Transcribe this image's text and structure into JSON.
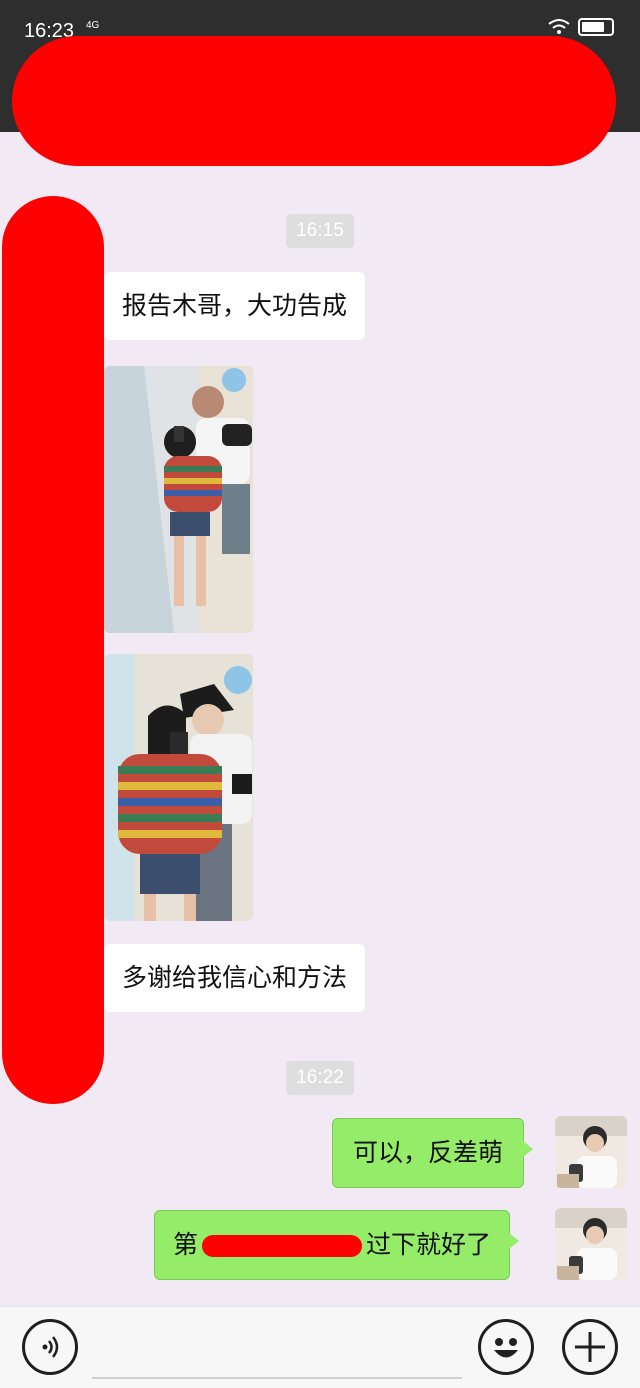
{
  "status_bar": {
    "time": "16:23",
    "network": "4G"
  },
  "messages": [
    {
      "type": "timestamp",
      "text": "16:15"
    },
    {
      "type": "text",
      "direction": "in",
      "text": "报告木哥，大功告成"
    },
    {
      "type": "image",
      "direction": "in"
    },
    {
      "type": "image",
      "direction": "in"
    },
    {
      "type": "text",
      "direction": "in",
      "text": "多谢给我信心和方法"
    },
    {
      "type": "timestamp",
      "text": "16:22"
    },
    {
      "type": "text",
      "direction": "out",
      "text": "可以，反差萌"
    },
    {
      "type": "text",
      "direction": "out",
      "text_prefix": "第",
      "text_suffix": "过下就好了"
    }
  ],
  "input_bar": {
    "voice_icon": "voice-icon",
    "emoji_icon": "emoji-icon",
    "plus_icon": "plus-icon"
  },
  "colors": {
    "chat_background": "#f1e9f3",
    "outgoing_bubble": "#95ec69",
    "incoming_bubble": "#ffffff",
    "redaction": "#ff0000",
    "header": "#2e2e2e"
  }
}
